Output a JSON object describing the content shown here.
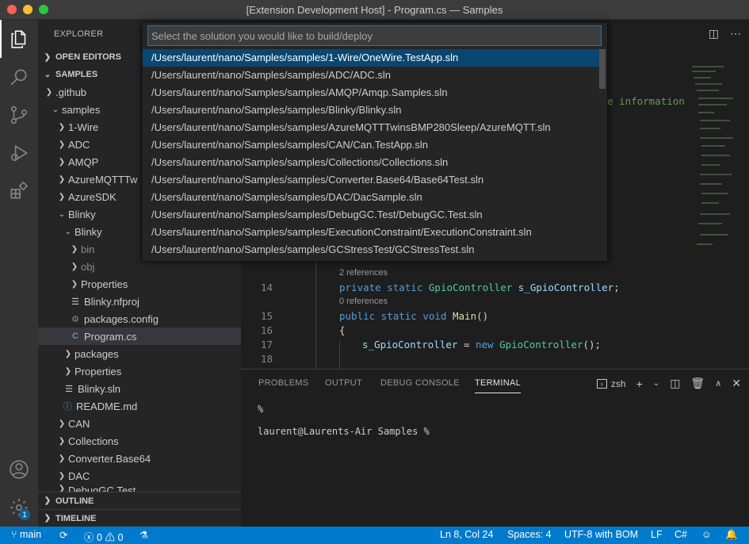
{
  "window": {
    "title": "[Extension Development Host] - Program.cs — Samples"
  },
  "quick_pick": {
    "placeholder": "Select the solution you would like to build/deploy",
    "items": [
      "/Users/laurent/nano/Samples/samples/1-Wire/OneWire.TestApp.sln",
      "/Users/laurent/nano/Samples/samples/ADC/ADC.sln",
      "/Users/laurent/nano/Samples/samples/AMQP/Amqp.Samples.sln",
      "/Users/laurent/nano/Samples/samples/Blinky/Blinky.sln",
      "/Users/laurent/nano/Samples/samples/AzureMQTTTwinsBMP280Sleep/AzureMQTT.sln",
      "/Users/laurent/nano/Samples/samples/CAN/Can.TestApp.sln",
      "/Users/laurent/nano/Samples/samples/Collections/Collections.sln",
      "/Users/laurent/nano/Samples/samples/Converter.Base64/Base64Test.sln",
      "/Users/laurent/nano/Samples/samples/DAC/DacSample.sln",
      "/Users/laurent/nano/Samples/samples/DebugGC.Test/DebugGC.Test.sln",
      "/Users/laurent/nano/Samples/samples/ExecutionConstraint/ExecutionConstraint.sln",
      "/Users/laurent/nano/Samples/samples/GCStressTest/GCStressTest.sln"
    ]
  },
  "sidebar": {
    "title": "EXPLORER",
    "open_editors": "OPEN EDITORS",
    "workspace": "SAMPLES",
    "outline": "OUTLINE",
    "timeline": "TIMELINE",
    "tree": [
      ".github",
      "samples",
      "1-Wire",
      "ADC",
      "AMQP",
      "AzureMQTTTw",
      "AzureSDK",
      "Blinky",
      "Blinky",
      "bin",
      "obj",
      "Properties",
      "Blinky.nfproj",
      "packages.config",
      "Program.cs",
      "packages",
      "Properties",
      "Blinky.sln",
      "README.md",
      "CAN",
      "Collections",
      "Converter.Base64",
      "DAC",
      "DebugGC.Test"
    ]
  },
  "editor": {
    "hint_text": "e information",
    "lines": [
      {
        "num": "14",
        "refs": "2 references"
      },
      {
        "num": "15",
        "refs": "0 references"
      },
      {
        "num": "16"
      },
      {
        "num": "17"
      },
      {
        "num": "18"
      }
    ],
    "code": {
      "l14": {
        "kw": "private static",
        "type": "GpioController",
        "id": "s_GpioController;"
      },
      "l15": {
        "kw": "public static void",
        "fn": "Main",
        "rest": "()"
      },
      "l16": {
        "text": "{"
      },
      "l17": {
        "id": "s_GpioController",
        "eq": " = ",
        "kw": "new",
        "type": "GpioController",
        "rest": "();"
      }
    }
  },
  "panel": {
    "tabs": [
      "PROBLEMS",
      "OUTPUT",
      "DEBUG CONSOLE",
      "TERMINAL"
    ],
    "shell": "zsh",
    "cursor_glyph": "%",
    "prompt": "laurent@Laurents-Air Samples %"
  },
  "status": {
    "branch": "main",
    "errors": "0",
    "warnings": "0",
    "position": "Ln 8, Col 24",
    "spaces": "Spaces: 4",
    "encoding": "UTF-8 with BOM",
    "eol": "LF",
    "language": "C#"
  },
  "badges": {
    "accounts": "1"
  },
  "colors": {
    "accent": "#007acc",
    "selection": "#094771",
    "status_bar": "#007acc"
  }
}
